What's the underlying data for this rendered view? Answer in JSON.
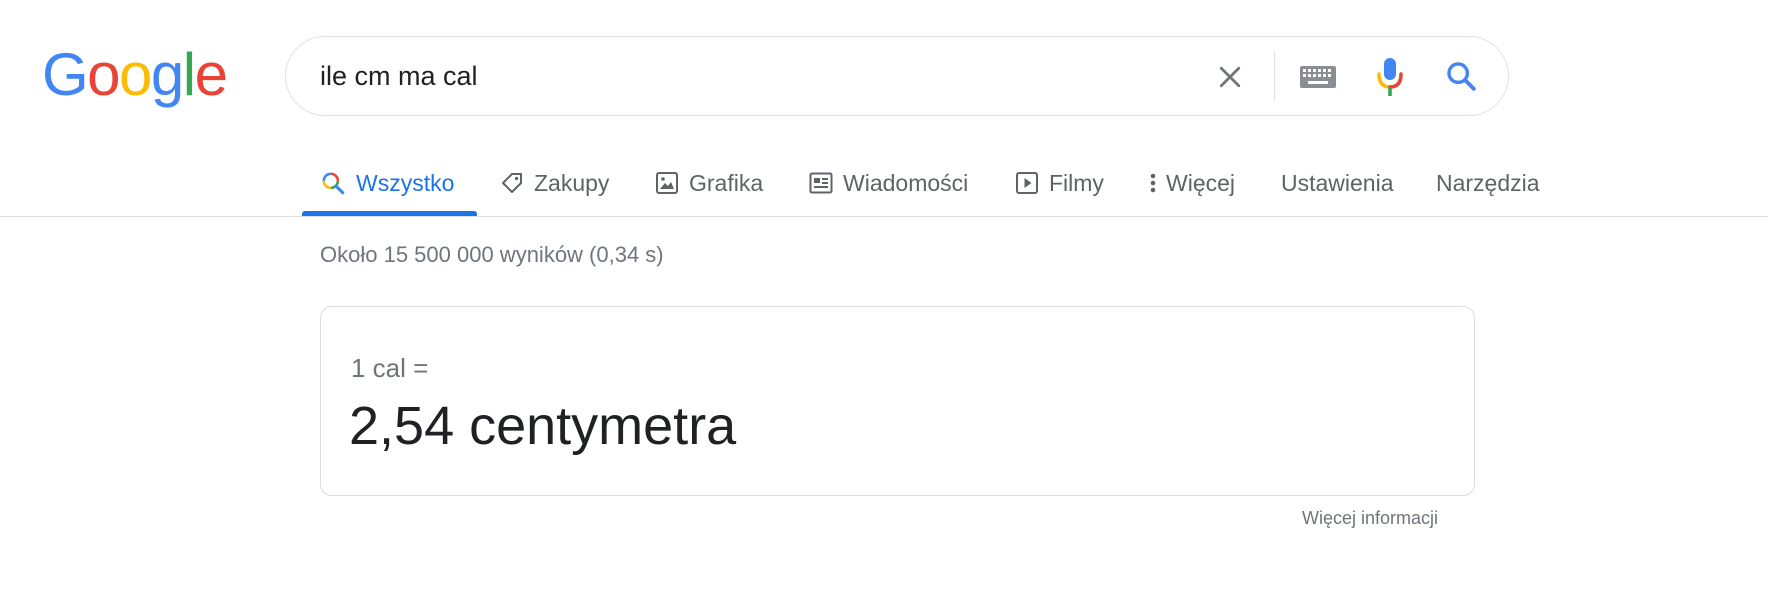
{
  "logo": {
    "letters": [
      {
        "char": "G",
        "color": "#4285f4"
      },
      {
        "char": "o",
        "color": "#ea4335"
      },
      {
        "char": "o",
        "color": "#fbbc05"
      },
      {
        "char": "g",
        "color": "#4285f4"
      },
      {
        "char": "l",
        "color": "#34a853"
      },
      {
        "char": "e",
        "color": "#ea4335"
      }
    ]
  },
  "search": {
    "value": "ile cm ma cal",
    "clear_icon": "close-icon",
    "keyboard_icon": "keyboard-icon",
    "mic_icon": "microphone-icon",
    "search_icon": "search-icon"
  },
  "tabs": [
    {
      "label": "Wszystko",
      "icon": "search-multicolor-icon",
      "active": true
    },
    {
      "label": "Zakupy",
      "icon": "tag-icon"
    },
    {
      "label": "Grafika",
      "icon": "image-icon"
    },
    {
      "label": "Wiadomości",
      "icon": "newspaper-icon"
    },
    {
      "label": "Filmy",
      "icon": "play-icon"
    },
    {
      "label": "Więcej",
      "icon": "more-vertical-icon"
    },
    {
      "label": "Ustawienia"
    },
    {
      "label": "Narzędzia"
    }
  ],
  "results": {
    "stats": "Około 15 500 000 wyników (0,34 s)"
  },
  "converter": {
    "from": "1 cal =",
    "result": "2,54 centymetra",
    "more_info": "Więcej informacji"
  },
  "colors": {
    "accent": "#1a73e8",
    "muted_text": "#70757a",
    "border": "#dadce0"
  }
}
